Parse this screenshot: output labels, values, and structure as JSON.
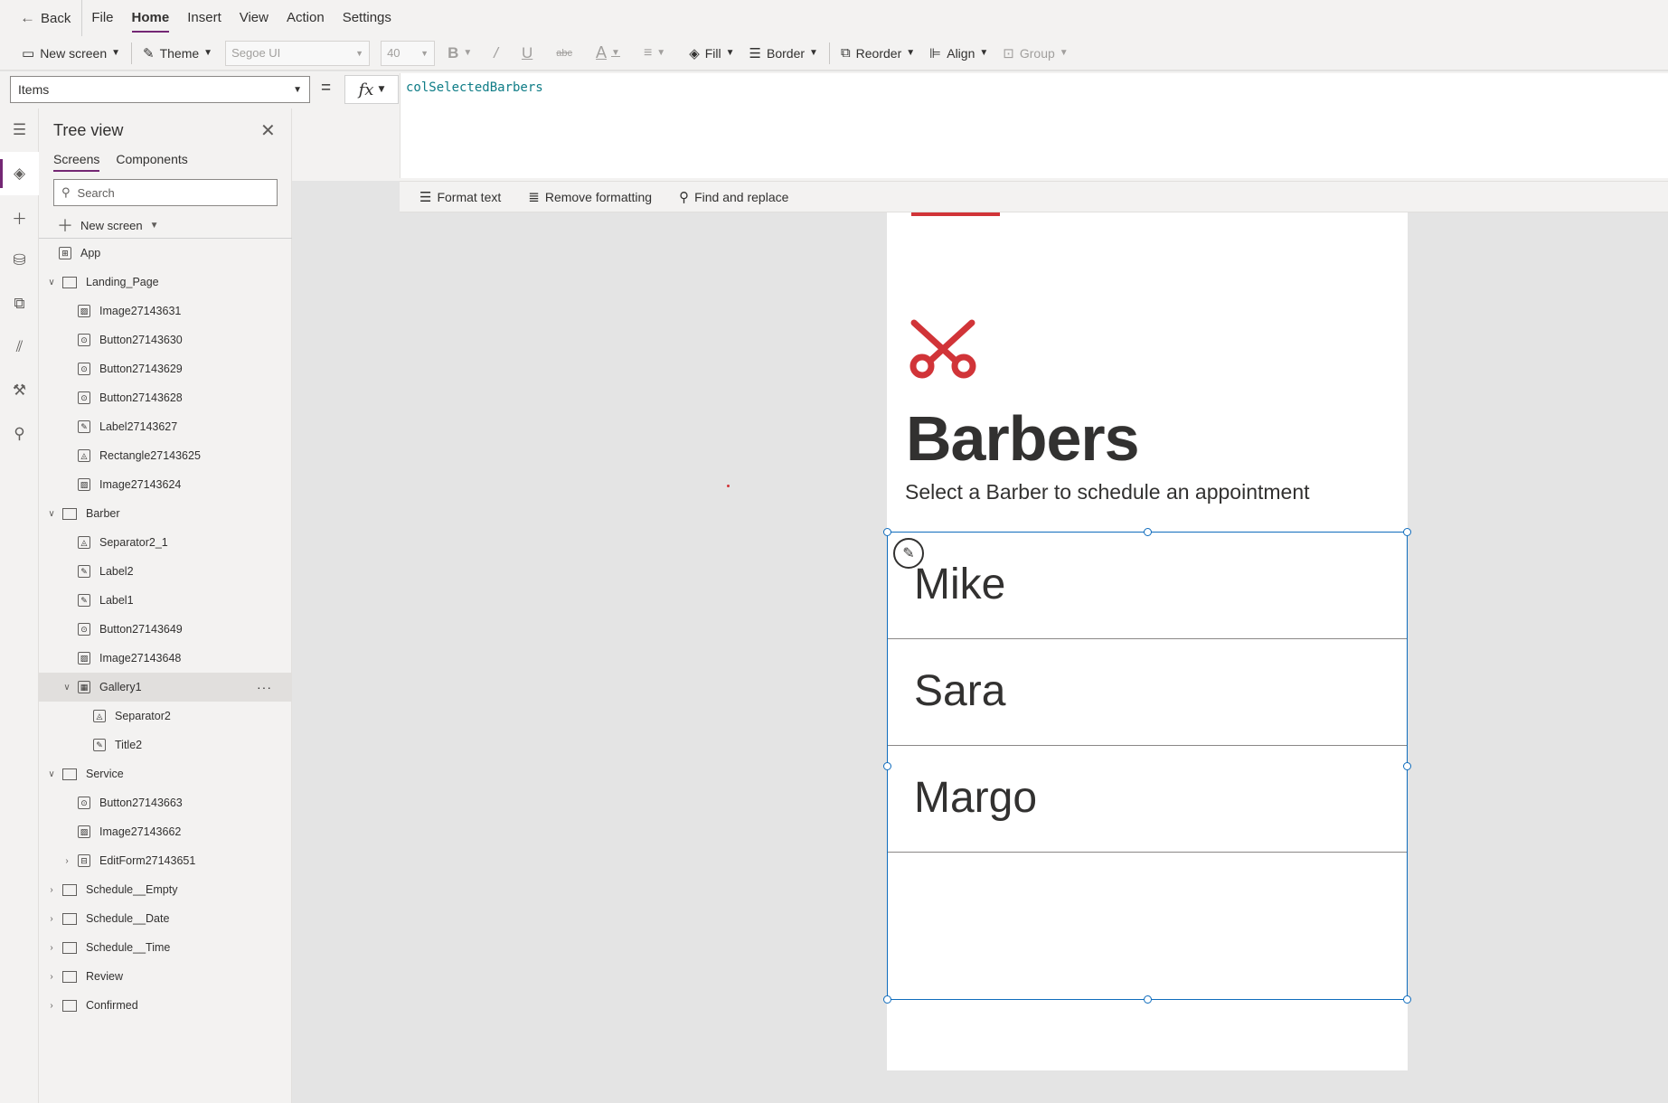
{
  "menubar": {
    "back": "Back",
    "items": [
      "File",
      "Home",
      "Insert",
      "View",
      "Action",
      "Settings"
    ],
    "active": "Home"
  },
  "toolbar": {
    "new_screen": "New screen",
    "theme": "Theme",
    "font": "Segoe UI",
    "font_size": "40",
    "bold": "B",
    "italic": "/",
    "underline": "U",
    "strike": "abc",
    "font_color": "A",
    "fill": "Fill",
    "border": "Border",
    "reorder": "Reorder",
    "align": "Align",
    "group": "Group"
  },
  "formula": {
    "property": "Items",
    "equals": "=",
    "fx": "fx",
    "value": "colSelectedBarbers"
  },
  "format_bar": {
    "format_text": "Format text",
    "remove_formatting": "Remove formatting",
    "find_replace": "Find and replace"
  },
  "tree": {
    "title": "Tree view",
    "tabs": [
      "Screens",
      "Components"
    ],
    "search_placeholder": "Search",
    "new_screen": "New screen",
    "nodes": [
      {
        "label": "App",
        "type": "app",
        "level": 0,
        "expand": ""
      },
      {
        "label": "Landing_Page",
        "type": "screen",
        "level": 0,
        "expand": "v"
      },
      {
        "label": "Image27143631",
        "type": "image",
        "level": 1,
        "expand": ""
      },
      {
        "label": "Button27143630",
        "type": "button",
        "level": 1,
        "expand": ""
      },
      {
        "label": "Button27143629",
        "type": "button",
        "level": 1,
        "expand": ""
      },
      {
        "label": "Button27143628",
        "type": "button",
        "level": 1,
        "expand": ""
      },
      {
        "label": "Label27143627",
        "type": "label",
        "level": 1,
        "expand": ""
      },
      {
        "label": "Rectangle27143625",
        "type": "shape",
        "level": 1,
        "expand": ""
      },
      {
        "label": "Image27143624",
        "type": "image",
        "level": 1,
        "expand": ""
      },
      {
        "label": "Barber",
        "type": "screen",
        "level": 0,
        "expand": "v"
      },
      {
        "label": "Separator2_1",
        "type": "shape",
        "level": 1,
        "expand": ""
      },
      {
        "label": "Label2",
        "type": "label",
        "level": 1,
        "expand": ""
      },
      {
        "label": "Label1",
        "type": "label",
        "level": 1,
        "expand": ""
      },
      {
        "label": "Button27143649",
        "type": "button",
        "level": 1,
        "expand": ""
      },
      {
        "label": "Image27143648",
        "type": "image",
        "level": 1,
        "expand": ""
      },
      {
        "label": "Gallery1",
        "type": "gallery",
        "level": 1,
        "expand": "v",
        "selected": true,
        "more": "···"
      },
      {
        "label": "Separator2",
        "type": "shape",
        "level": 2,
        "expand": ""
      },
      {
        "label": "Title2",
        "type": "label",
        "level": 2,
        "expand": ""
      },
      {
        "label": "Service",
        "type": "screen",
        "level": 0,
        "expand": "v"
      },
      {
        "label": "Button27143663",
        "type": "button",
        "level": 1,
        "expand": ""
      },
      {
        "label": "Image27143662",
        "type": "image",
        "level": 1,
        "expand": ""
      },
      {
        "label": "EditForm27143651",
        "type": "form",
        "level": 1,
        "expand": ">"
      },
      {
        "label": "Schedule__Empty",
        "type": "screen",
        "level": 0,
        "expand": ">"
      },
      {
        "label": "Schedule__Date",
        "type": "screen",
        "level": 0,
        "expand": ">"
      },
      {
        "label": "Schedule__Time",
        "type": "screen",
        "level": 0,
        "expand": ">"
      },
      {
        "label": "Review",
        "type": "screen",
        "level": 0,
        "expand": ">"
      },
      {
        "label": "Confirmed",
        "type": "screen",
        "level": 0,
        "expand": ">"
      }
    ]
  },
  "app_screen": {
    "title": "Barbers",
    "subtitle": "Select a Barber to schedule an appointment",
    "icon": "scissors-icon",
    "accent_color": "#d13438",
    "gallery_items": [
      "Mike",
      "Sara",
      "Margo"
    ]
  },
  "colors": {
    "brand": "#742774",
    "selection": "#0f6cbd",
    "formula_text": "#0e7c86"
  }
}
